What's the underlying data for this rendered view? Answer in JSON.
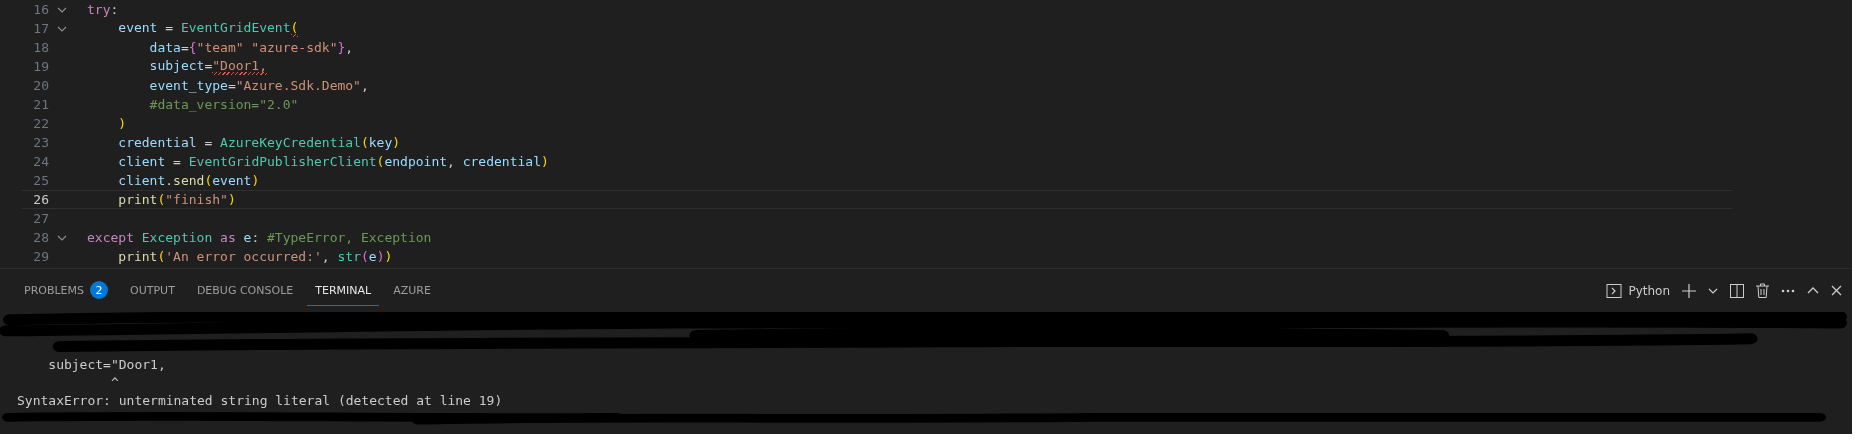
{
  "editor": {
    "lines": [
      {
        "number": "16",
        "foldable": true,
        "current": false,
        "tokens": [
          {
            "text": "try",
            "kind": "kw"
          },
          {
            "text": ":",
            "kind": "plain"
          }
        ]
      },
      {
        "number": "17",
        "foldable": true,
        "current": false,
        "tokens": [
          {
            "text": "    event",
            "kind": "var"
          },
          {
            "text": " = ",
            "kind": "plain"
          },
          {
            "text": "EventGridEvent",
            "kind": "cls"
          },
          {
            "text": "(",
            "kind": "b1",
            "error": true
          }
        ]
      },
      {
        "number": "18",
        "foldable": false,
        "current": false,
        "tokens": [
          {
            "text": "        data",
            "kind": "var"
          },
          {
            "text": "=",
            "kind": "plain"
          },
          {
            "text": "{",
            "kind": "b2"
          },
          {
            "text": "\"team\" \"azure-sdk\"",
            "kind": "str"
          },
          {
            "text": "}",
            "kind": "b2"
          },
          {
            "text": ",",
            "kind": "plain"
          }
        ]
      },
      {
        "number": "19",
        "foldable": false,
        "current": false,
        "tokens": [
          {
            "text": "        subject",
            "kind": "var"
          },
          {
            "text": "=",
            "kind": "plain"
          },
          {
            "text": "\"Door1,",
            "kind": "str",
            "error": true
          }
        ]
      },
      {
        "number": "20",
        "foldable": false,
        "current": false,
        "tokens": [
          {
            "text": "        event_type",
            "kind": "var"
          },
          {
            "text": "=",
            "kind": "plain"
          },
          {
            "text": "\"Azure.Sdk.Demo\"",
            "kind": "str"
          },
          {
            "text": ",",
            "kind": "plain"
          }
        ]
      },
      {
        "number": "21",
        "foldable": false,
        "current": false,
        "tokens": [
          {
            "text": "        #data_version=\"2.0\"",
            "kind": "cmt"
          }
        ]
      },
      {
        "number": "22",
        "foldable": false,
        "current": false,
        "tokens": [
          {
            "text": "    )",
            "kind": "b1"
          }
        ]
      },
      {
        "number": "23",
        "foldable": false,
        "current": false,
        "tokens": [
          {
            "text": "    credential",
            "kind": "var"
          },
          {
            "text": " = ",
            "kind": "plain"
          },
          {
            "text": "AzureKeyCredential",
            "kind": "cls"
          },
          {
            "text": "(",
            "kind": "b1"
          },
          {
            "text": "key",
            "kind": "var"
          },
          {
            "text": ")",
            "kind": "b1"
          }
        ]
      },
      {
        "number": "24",
        "foldable": false,
        "current": false,
        "tokens": [
          {
            "text": "    client",
            "kind": "var"
          },
          {
            "text": " = ",
            "kind": "plain"
          },
          {
            "text": "EventGridPublisherClient",
            "kind": "cls"
          },
          {
            "text": "(",
            "kind": "b1"
          },
          {
            "text": "endpoint",
            "kind": "var"
          },
          {
            "text": ", ",
            "kind": "plain"
          },
          {
            "text": "credential",
            "kind": "var"
          },
          {
            "text": ")",
            "kind": "b1"
          }
        ]
      },
      {
        "number": "25",
        "foldable": false,
        "current": false,
        "tokens": [
          {
            "text": "    client",
            "kind": "var"
          },
          {
            "text": ".",
            "kind": "plain"
          },
          {
            "text": "send",
            "kind": "fn"
          },
          {
            "text": "(",
            "kind": "b1"
          },
          {
            "text": "event",
            "kind": "var"
          },
          {
            "text": ")",
            "kind": "b1"
          }
        ]
      },
      {
        "number": "26",
        "foldable": false,
        "current": true,
        "tokens": [
          {
            "text": "    print",
            "kind": "fn"
          },
          {
            "text": "(",
            "kind": "b1"
          },
          {
            "text": "\"finish\"",
            "kind": "str"
          },
          {
            "text": ")",
            "kind": "b1"
          }
        ]
      },
      {
        "number": "27",
        "foldable": false,
        "current": false
      },
      {
        "number": "28",
        "foldable": true,
        "current": false,
        "tokens": [
          {
            "text": "except",
            "kind": "kw"
          },
          {
            "text": " Exception",
            "kind": "cls"
          },
          {
            "text": " as ",
            "kind": "kw"
          },
          {
            "text": "e",
            "kind": "var"
          },
          {
            "text": ": ",
            "kind": "plain"
          },
          {
            "text": "#TypeError, Exception",
            "kind": "cmt"
          }
        ]
      },
      {
        "number": "29",
        "foldable": false,
        "current": false,
        "tokens": [
          {
            "text": "    print",
            "kind": "fn"
          },
          {
            "text": "(",
            "kind": "b1"
          },
          {
            "text": "'An error occurred:'",
            "kind": "str"
          },
          {
            "text": ", ",
            "kind": "plain"
          },
          {
            "text": "str",
            "kind": "cls"
          },
          {
            "text": "(",
            "kind": "b2"
          },
          {
            "text": "e",
            "kind": "var"
          },
          {
            "text": ")",
            "kind": "b2"
          },
          {
            "text": ")",
            "kind": "b1"
          }
        ]
      }
    ]
  },
  "panel": {
    "tabs": [
      {
        "label": "PROBLEMS",
        "badge": "2",
        "selected": false
      },
      {
        "label": "OUTPUT",
        "selected": false
      },
      {
        "label": "DEBUG CONSOLE",
        "selected": false
      },
      {
        "label": "TERMINAL",
        "selected": true
      },
      {
        "label": "AZURE",
        "selected": false
      }
    ],
    "terminal_name": "Python",
    "terminal_lines": [
      "    subject=\"Door1,",
      "            ^",
      "SyntaxError: unterminated string literal (detected at line 19)"
    ]
  }
}
